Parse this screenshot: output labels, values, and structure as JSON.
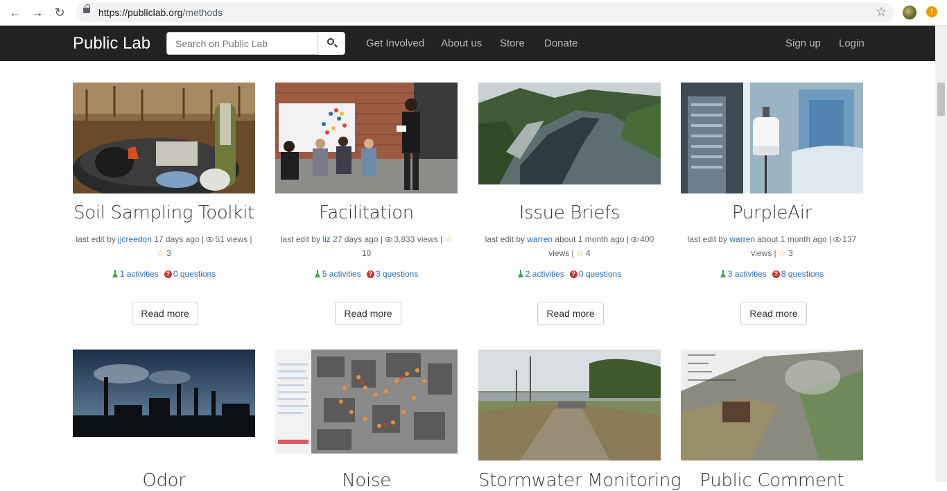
{
  "browser": {
    "url_host": "https://publiclab.org",
    "url_path": "/methods",
    "alert_glyph": "!"
  },
  "navbar": {
    "brand": "Public Lab",
    "search_placeholder": "Search on Public Lab",
    "links": [
      "Get Involved",
      "About us",
      "Store",
      "Donate"
    ],
    "right_links": [
      "Sign up",
      "Login"
    ]
  },
  "cards": [
    {
      "title": "Soil Sampling Toolkit",
      "meta_prefix": "last edit by",
      "author": "jjcreedon",
      "age": "17 days ago |",
      "views": "51 views |",
      "stars": "3",
      "activities": "1 activities",
      "questions_count": "0",
      "questions_label": "questions",
      "button": "Read more"
    },
    {
      "title": "Facilitation",
      "meta_prefix": "last edit by",
      "author": "liz",
      "age": "27 days ago |",
      "views": "3,833 views |",
      "stars": "10",
      "activities": "5 activities",
      "questions_count": "3",
      "questions_label": "questions",
      "button": "Read more"
    },
    {
      "title": "Issue Briefs",
      "meta_prefix": "last edit by",
      "author": "warren",
      "age": "about 1 month ago |",
      "views": "400 views |",
      "stars": "4",
      "activities": "2 activities",
      "questions_count": "0",
      "questions_label": "questions",
      "button": "Read more"
    },
    {
      "title": "PurpleAir",
      "meta_prefix": "last edit by",
      "author": "warren",
      "age": "about 1 month ago |",
      "views": "137 views |",
      "stars": "3",
      "activities": "3 activities",
      "questions_count": "8",
      "questions_label": "questions",
      "button": "Read more"
    }
  ],
  "row2_titles": [
    "Odor",
    "Noise",
    "Stormwater Monitoring",
    "Public Comment"
  ],
  "colors": {
    "navbar": "#222222",
    "link": "#2a6ebb",
    "star": "#e8a23c",
    "question": "#d0302e",
    "activity": "#3ca055"
  }
}
